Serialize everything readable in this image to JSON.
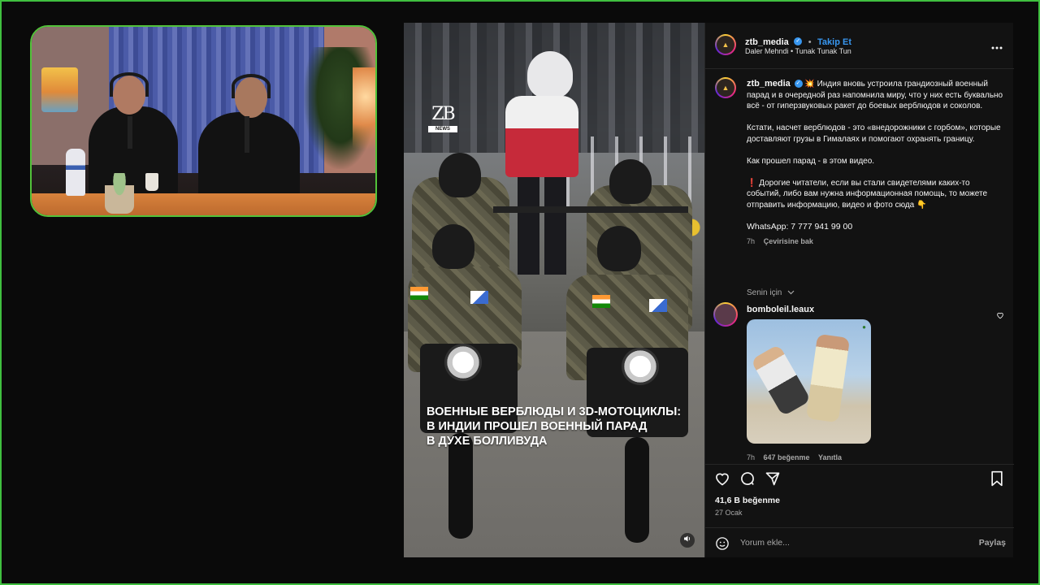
{
  "post": {
    "username": "ztb_media",
    "follow_label": "Takip Et",
    "music_artist": "Daler Mehndi",
    "music_song": "Tunak Tunak Tun",
    "more_label": "•••"
  },
  "video": {
    "logo_main": "ZB",
    "logo_sub": "NEWS",
    "caption_line1": "ВОЕННЫЕ ВЕРБЛЮДЫ И 3D-МОТОЦИКЛЫ:",
    "caption_line2": "В ИНДИИ ПРОШЕЛ ВОЕННЫЙ ПАРАД",
    "caption_line3": "В ДУХЕ БОЛЛИВУДА",
    "sound_icon": "speaker-icon"
  },
  "caption": {
    "username": "ztb_media",
    "emoji": "💥",
    "para1": "Индия вновь устроила грандиозный военный парад и в очередной раз напомнила миру, что у них есть буквально всё - от гиперзвуковых ракет до боевых верблюдов и соколов.",
    "para2": "Кстати, насчет верблюдов - это «внедорожники с горбом», которые доставляют грузы в Гималаях и помогают охранять границу.",
    "para3": "Как прошел парад - в этом видео.",
    "para4_emoji": "❗",
    "para4": "Дорогие читатели, если вы стали свидетелями каких-то событий, либо вам нужна информационная помощь, то можете отправить информацию, видео и фото сюда",
    "para4_end_emoji": "👇",
    "whatsapp": "WhatsApp: 7 777 941 99 00",
    "time": "7h",
    "translate": "Çevirisine bak"
  },
  "for_you": "Senin için",
  "comment": {
    "username": "bomboleil.leaux",
    "time": "7h",
    "likes": "647 beğenme",
    "reply": "Yanıtla"
  },
  "stats": {
    "likes": "41,6 B beğenme",
    "date": "27 Ocak"
  },
  "footer": {
    "placeholder": "Yorum ekle...",
    "share": "Paylaş"
  },
  "colors": {
    "frame_border": "#3fbf3f",
    "accent_blue": "#3897f0",
    "panel_bg": "#121212"
  }
}
